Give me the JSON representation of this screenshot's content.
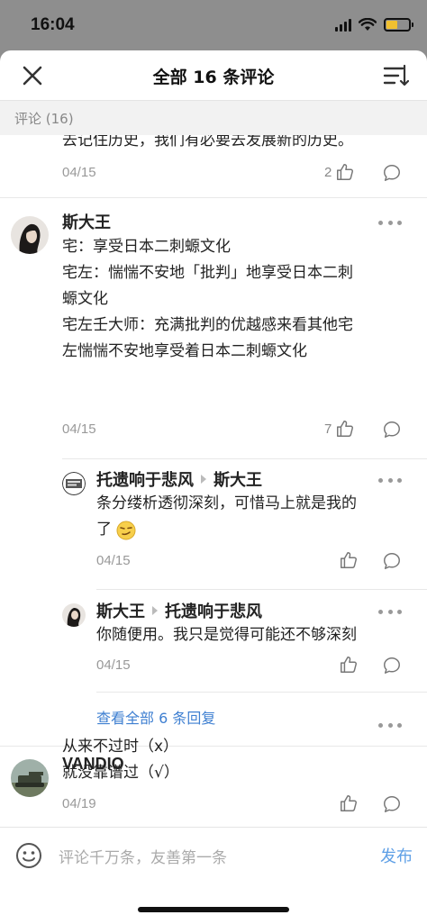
{
  "status": {
    "time": "16:04"
  },
  "header": {
    "title": "全部 16 条评论"
  },
  "section": {
    "label": "评论 (16)"
  },
  "comments": [
    {
      "text_lines": [
        "去记住历史，我们有必要去发展新的历史。"
      ],
      "date": "04/15",
      "likes": "2"
    },
    {
      "author": "斯大王",
      "text_lines": [
        "宅：享受日本二刺螈文化",
        "宅左：惴惴不安地「批判」地享受日本二刺",
        "螈文化",
        "宅左壬大师：充满批判的优越感来看其他宅",
        "左惴惴不安地享受着日本二刺螈文化"
      ],
      "date": "04/15",
      "likes": "7",
      "replies": [
        {
          "author": "托遗响于悲风",
          "reply_to": "斯大王",
          "text_lines": [
            "条分缕析透彻深刻，可惜马上就是我的",
            "了"
          ],
          "date": "04/15",
          "likes": ""
        },
        {
          "author": "斯大王",
          "reply_to": "托遗响于悲风",
          "text_lines": [
            "你随便用。我只是觉得可能还不够深刻"
          ],
          "date": "04/15",
          "likes": ""
        }
      ],
      "view_all": "查看全部 6 条回复"
    },
    {
      "author": "VANDIO",
      "text_lines": [
        "从来不过时（x）",
        "就没靠谱过（√）"
      ],
      "date": "04/19",
      "likes": ""
    }
  ],
  "input": {
    "placeholder": "评论千万条，友善第一条",
    "publish": "发布"
  },
  "colors": {
    "accent": "#3e7fd1",
    "publish": "#5fa0e6",
    "battery": "#f0c030"
  }
}
